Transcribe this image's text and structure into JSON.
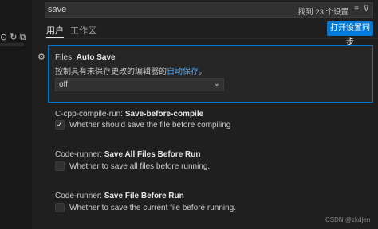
{
  "sidebar": {
    "icons": [
      "collapse-icon",
      "refresh-icon",
      "copy-icon"
    ],
    "glyphs": [
      "⊙",
      "↻",
      "⧉"
    ]
  },
  "search": {
    "value": "save",
    "result_count": "找到 23 个设置",
    "clear_glyph": "≡",
    "filter_glyph": "⊽"
  },
  "tabs": [
    {
      "label": "用户"
    },
    {
      "label": "工作区"
    }
  ],
  "sync_button": {
    "label": "打开设置同步"
  },
  "settings": [
    {
      "prefix": "Files: ",
      "name": "Auto Save",
      "description": "控制具有未保存更改的编辑器的",
      "link": "自动保存",
      "description_suffix": "。",
      "value": "off"
    },
    {
      "prefix": "C-cpp-compile-run: ",
      "name": "Save-before-compile",
      "description": "Whether should save the file before compiling",
      "checked": true
    },
    {
      "prefix": "Code-runner: ",
      "name": "Save All Files Before Run",
      "description": "Whether to save all files before running.",
      "checked": false
    },
    {
      "prefix": "Code-runner: ",
      "name": "Save File Before Run",
      "description": "Whether to save the current file before running.",
      "checked": false
    }
  ],
  "watermark": "CSDN @zkdjen"
}
